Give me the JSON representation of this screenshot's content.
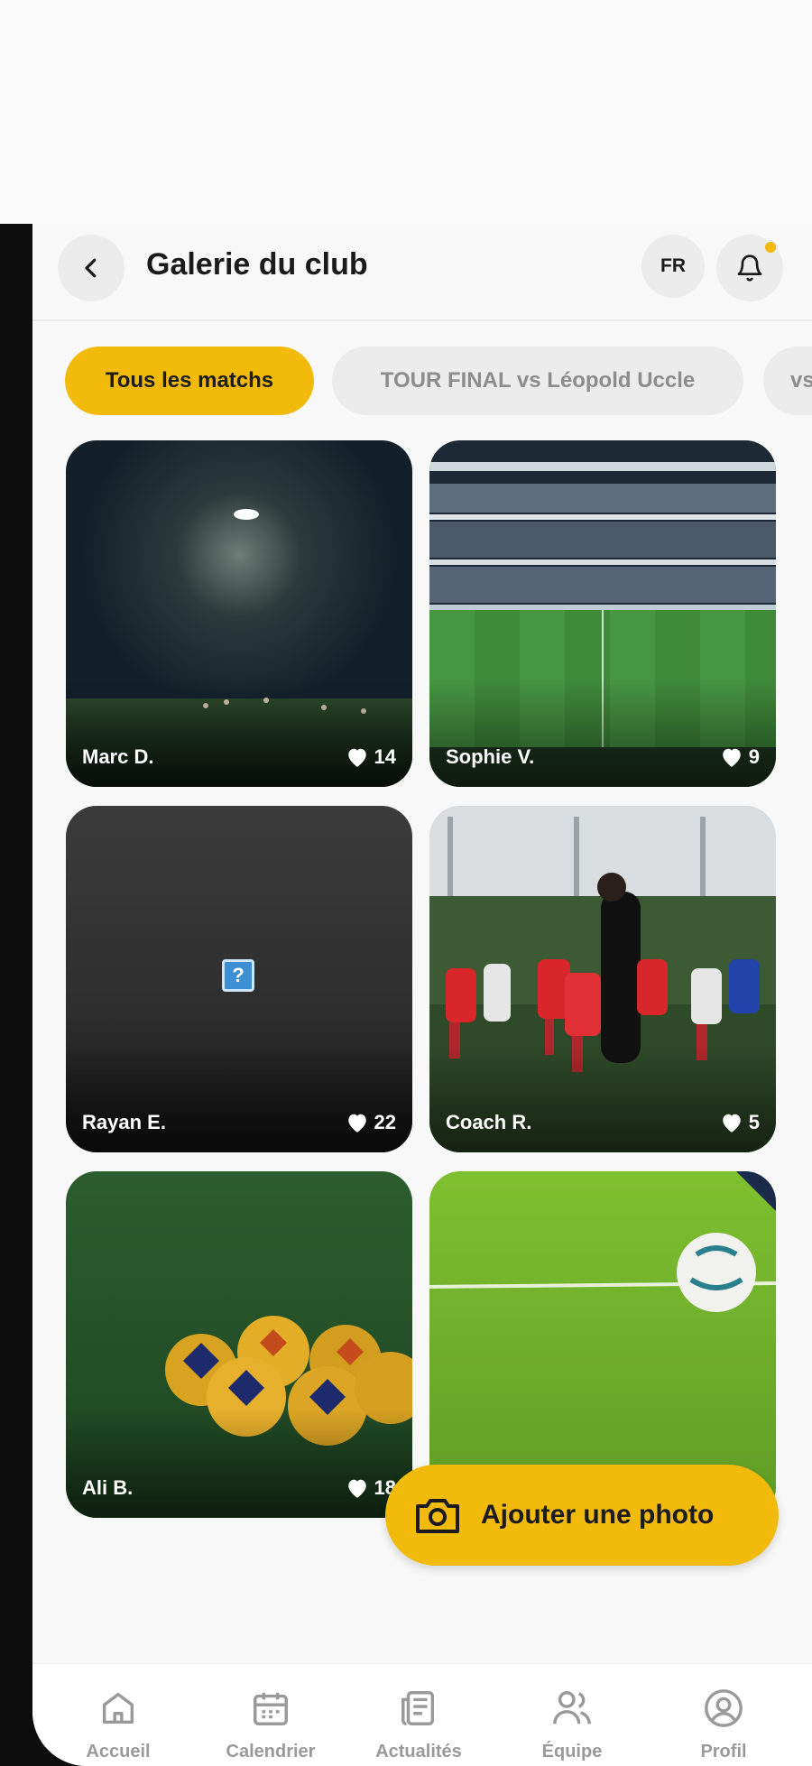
{
  "header": {
    "title": "Galerie du club",
    "language": "FR",
    "back_icon": "chevron-left-icon",
    "notification_icon": "bell-icon",
    "notification_dot_color": "#f0b90b"
  },
  "filters": [
    {
      "label": "Tous les matchs",
      "active": true
    },
    {
      "label": "TOUR FINAL vs Léopold Uccle",
      "active": false
    },
    {
      "label": "vs",
      "active": false
    }
  ],
  "photos": [
    {
      "author": "Marc D.",
      "likes": "14"
    },
    {
      "author": "Sophie V.",
      "likes": "9"
    },
    {
      "author": "Rayan E.",
      "likes": "22"
    },
    {
      "author": "Coach R.",
      "likes": "5"
    },
    {
      "author": "Ali B.",
      "likes": "18"
    },
    {
      "author": "",
      "likes": ""
    }
  ],
  "fab": {
    "label": "Ajouter une photo",
    "icon": "camera-icon"
  },
  "bottom_nav": [
    {
      "label": "Accueil",
      "icon": "home-icon"
    },
    {
      "label": "Calendrier",
      "icon": "calendar-icon"
    },
    {
      "label": "Actualités",
      "icon": "newspaper-icon"
    },
    {
      "label": "Équipe",
      "icon": "users-icon"
    },
    {
      "label": "Profil",
      "icon": "user-circle-icon"
    }
  ],
  "colors": {
    "accent": "#f2bb0c",
    "chip_inactive": "#ececec"
  }
}
